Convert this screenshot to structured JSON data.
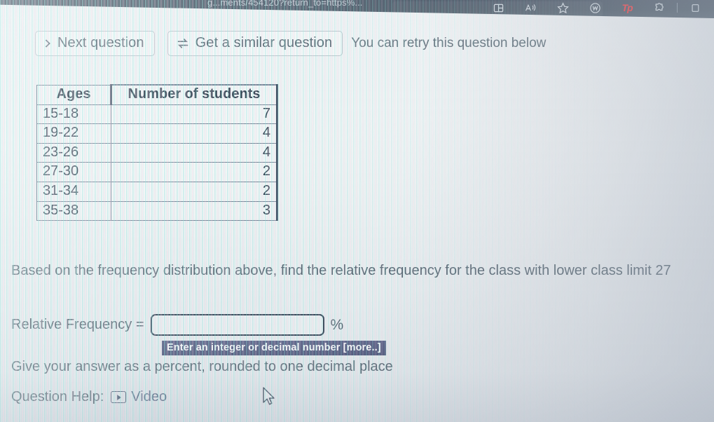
{
  "browser": {
    "url_fragment": "g...ments/454120?return_to=https%...",
    "toolbar_icons": [
      {
        "name": "split-screen-icon",
        "glyph": "⊞"
      },
      {
        "name": "read-aloud-icon",
        "glyph": "A"
      },
      {
        "name": "favorites-star-icon",
        "glyph": "☆"
      },
      {
        "name": "workspaces-icon",
        "glyph": "Ⓦ"
      },
      {
        "name": "extension-tp-icon",
        "glyph": "Tp"
      },
      {
        "name": "puzzle-extensions-icon",
        "glyph": "✾"
      }
    ]
  },
  "actions": {
    "next_question_label": "Next question",
    "similar_question_label": "Get a similar question",
    "retry_note": "You can retry this question below"
  },
  "table": {
    "headers": [
      "Ages",
      "Number of students"
    ],
    "rows": [
      {
        "ages": "15-18",
        "count": "7"
      },
      {
        "ages": "19-22",
        "count": "4"
      },
      {
        "ages": "23-26",
        "count": "4"
      },
      {
        "ages": "27-30",
        "count": "2"
      },
      {
        "ages": "31-34",
        "count": "2"
      },
      {
        "ages": "35-38",
        "count": "3"
      }
    ]
  },
  "question": {
    "prompt": "Based on the frequency distribution above, find the relative frequency for the class with lower class limit 27",
    "answer_label": "Relative Frequency =",
    "answer_value": "",
    "answer_placeholder": "",
    "percent_sign": "%",
    "input_hint": "Enter an integer or decimal number [more..]",
    "rounding_note": "Give your answer as a percent, rounded to one decimal place"
  },
  "help": {
    "label": "Question Help:",
    "video_label": "Video"
  },
  "chart_data": {
    "type": "table",
    "title": "Frequency distribution of student ages",
    "categories": [
      "15-18",
      "19-22",
      "23-26",
      "27-30",
      "31-34",
      "35-38"
    ],
    "values": [
      7,
      4,
      4,
      2,
      2,
      3
    ],
    "xlabel": "Ages",
    "ylabel": "Number of students"
  },
  "colors": {
    "chrome_bg": "#41505f",
    "tooltip_bg": "#545a80",
    "table_border": "#6f7f92",
    "text": "#53626e",
    "link": "#5a6b86",
    "accent_red": "#e8353a"
  }
}
